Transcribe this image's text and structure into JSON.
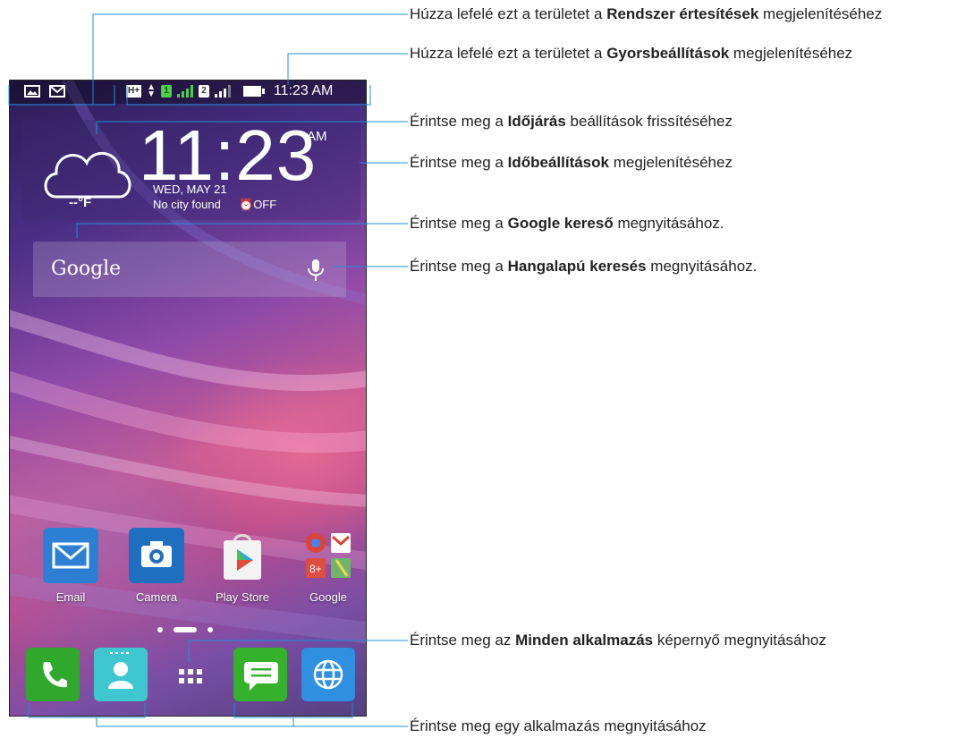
{
  "status_bar": {
    "time": "11:23 AM",
    "network_type": "H+",
    "sim1": "1",
    "sim2": "2",
    "notification_icons": [
      "picture-icon",
      "gmail-icon"
    ]
  },
  "clock_widget": {
    "time": "11:23",
    "ampm": "AM",
    "date": "WED, MAY 21",
    "city": "No city found",
    "alarm": "OFF",
    "temperature": "--°F"
  },
  "search_widget": {
    "brand": "Google",
    "mic_icon": "microphone-icon"
  },
  "apps": [
    {
      "label": "Email",
      "icon": "email-icon",
      "color": "#2d7fd3"
    },
    {
      "label": "Camera",
      "icon": "camera-icon",
      "color": "#1f6fc0"
    },
    {
      "label": "Play Store",
      "icon": "play-store-icon",
      "color": "#f5f5f5"
    },
    {
      "label": "Google",
      "icon": "google-folder-icon",
      "color": "#ffffff"
    }
  ],
  "dock": [
    {
      "name": "phone",
      "icon": "phone-icon",
      "color": "#2fa82c"
    },
    {
      "name": "contacts",
      "icon": "contacts-icon",
      "color": "#3ec7d0"
    },
    {
      "name": "all-apps",
      "icon": "all-apps-icon",
      "color": "transparent"
    },
    {
      "name": "messages",
      "icon": "messages-icon",
      "color": "#35b12c"
    },
    {
      "name": "browser",
      "icon": "browser-icon",
      "color": "#2f8fe0"
    }
  ],
  "callouts": {
    "c1": {
      "pre": "Húzza lefelé ezt a területet a ",
      "bold": "Rendszer értesítések",
      "post": " megjelenítéséhez"
    },
    "c2": {
      "pre": "Húzza lefelé ezt a területet a ",
      "bold": "Gyorsbeállítások",
      "post": " megjelenítéséhez"
    },
    "c3": {
      "pre": "Érintse meg a ",
      "bold": "Időjárás",
      "post": " beállítások frissítéséhez"
    },
    "c4": {
      "pre": "Érintse meg a ",
      "bold": "Időbeállítások",
      "post": " megjelenítéséhez"
    },
    "c5": {
      "pre": "Érintse meg a ",
      "bold": "Google kereső",
      "post": " megnyitásához."
    },
    "c6": {
      "pre": "Érintse meg a ",
      "bold": "Hangalapú keresés",
      "post": " megnyitásához."
    },
    "c7": {
      "pre": "Érintse meg az ",
      "bold": "Minden alkalmazás",
      "post": " képernyő megnyitásához"
    },
    "c8": {
      "pre": "Érintse meg egy alkalmazás megnyitásához",
      "bold": "",
      "post": ""
    }
  }
}
